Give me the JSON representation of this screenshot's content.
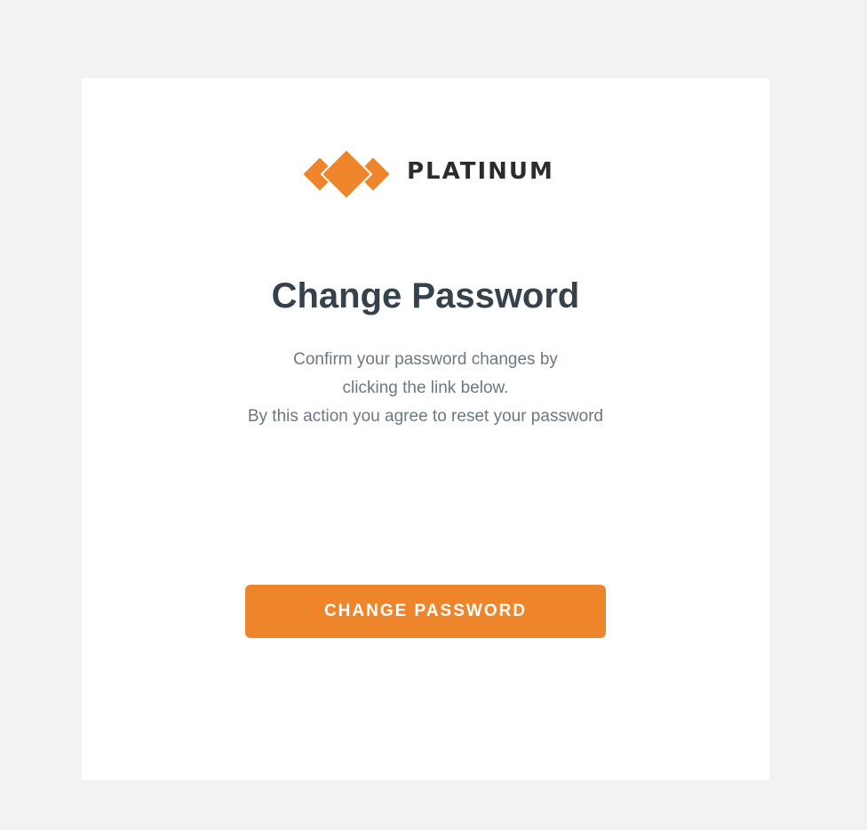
{
  "brand": {
    "name": "PLATINUM",
    "accent_color": "#ee852b",
    "logo_icon": "orange-diamonds-icon"
  },
  "heading": {
    "title": "Change Password"
  },
  "message": {
    "lines": [
      "Confirm your password changes by",
      "clicking the link below.",
      "By this action you agree to reset your password"
    ]
  },
  "actions": {
    "change_password_label": "CHANGE PASSWORD"
  }
}
